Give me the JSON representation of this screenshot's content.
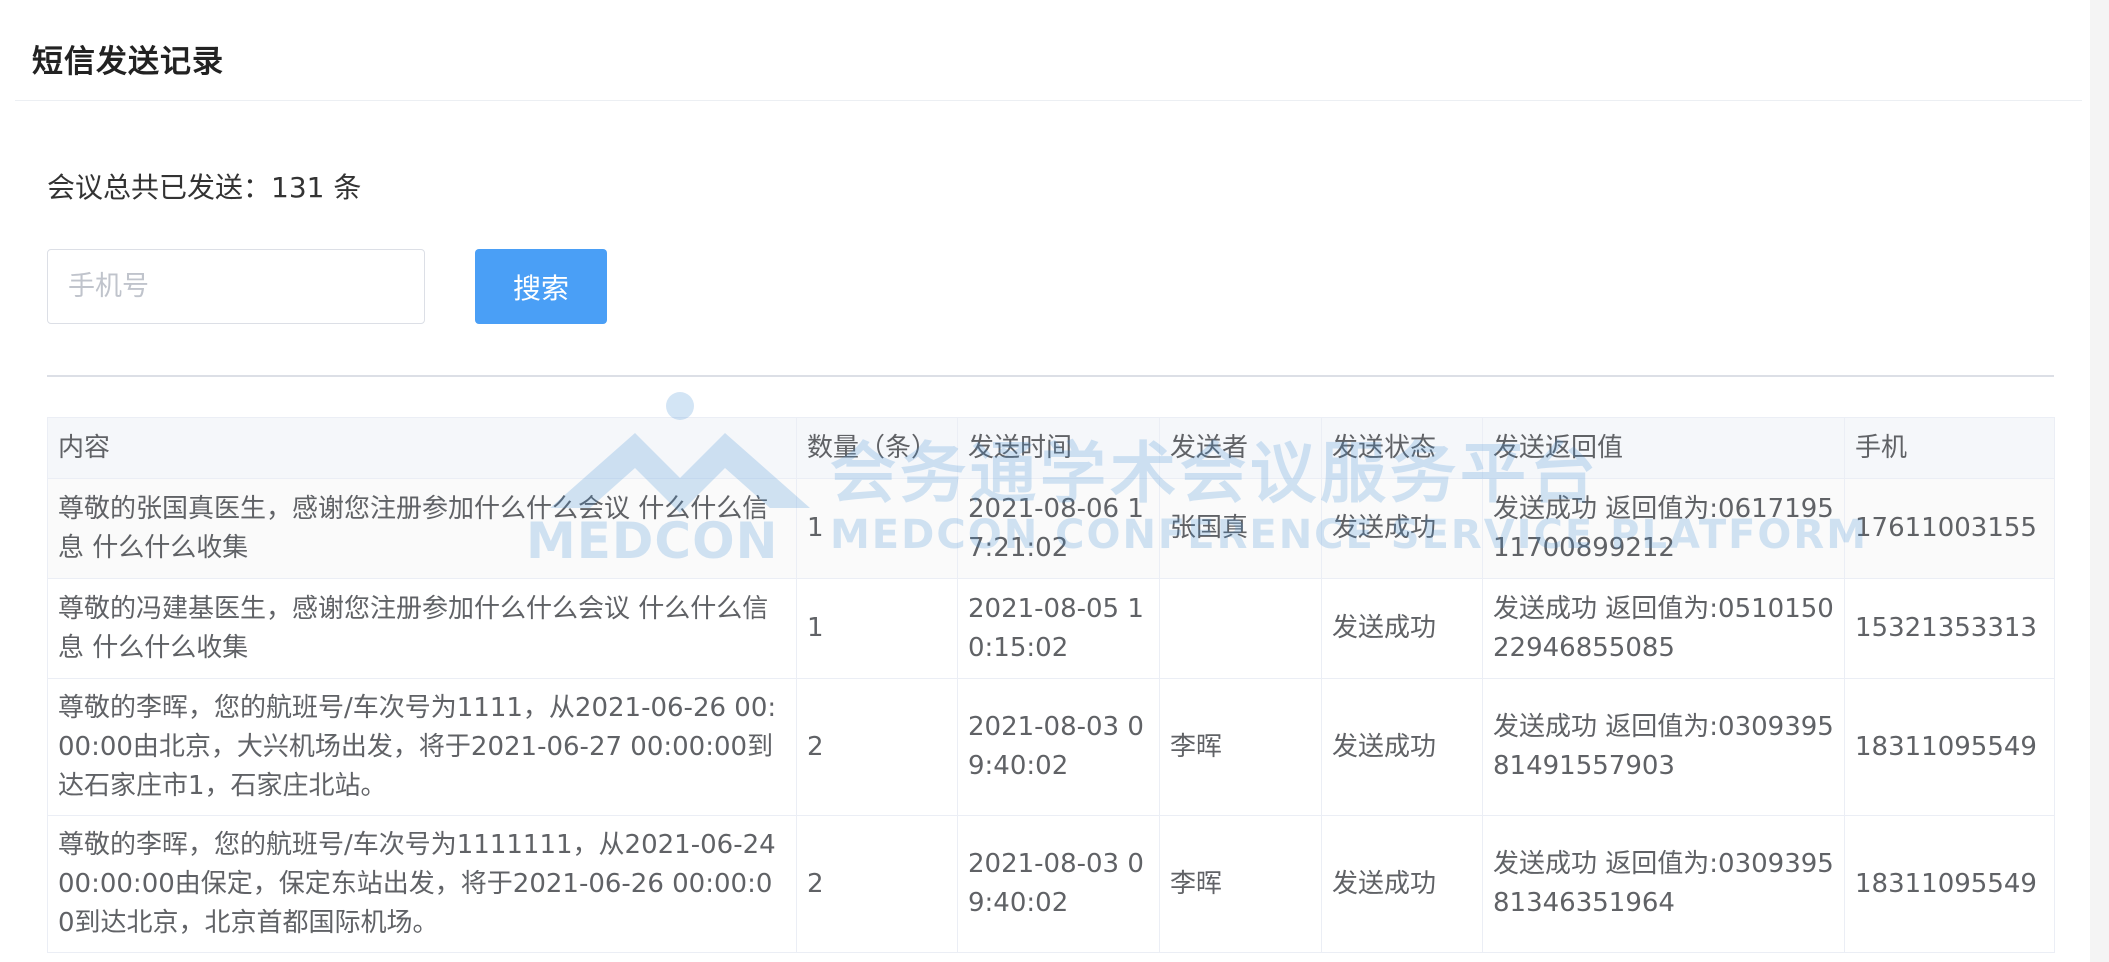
{
  "header": {
    "title": "短信发送记录"
  },
  "summary": {
    "label": "会议总共已发送：",
    "count": "131",
    "unit": "条",
    "text": "会议总共已发送：131 条"
  },
  "search": {
    "placeholder": "手机号",
    "value": "",
    "button_label": "搜索",
    "accent_color": "#4a9ff6"
  },
  "table": {
    "columns": [
      "内容",
      "数量（条）",
      "发送时间",
      "发送者",
      "发送状态",
      "发送返回值",
      "手机"
    ],
    "rows": [
      {
        "content": "尊敬的张国真医生，感谢您注册参加什么什么会议 什么什么信息 什么什么收集",
        "count": "1",
        "time": "2021-08-06 17:21:02",
        "sender": "张国真",
        "status": "发送成功",
        "result": "发送成功 返回值为:061719511700899212",
        "phone": "17611003155"
      },
      {
        "content": "尊敬的冯建基医生，感谢您注册参加什么什么会议 什么什么信息 什么什么收集",
        "count": "1",
        "time": "2021-08-05 10:15:02",
        "sender": "",
        "status": "发送成功",
        "result": "发送成功 返回值为:051015022946855085",
        "phone": "15321353313"
      },
      {
        "content": "尊敬的李晖，您的航班号/车次号为1111，从2021-06-26 00:00:00由北京，大兴机场出发，将于2021-06-27 00:00:00到达石家庄市1，石家庄北站。",
        "count": "2",
        "time": "2021-08-03 09:40:02",
        "sender": "李晖",
        "status": "发送成功",
        "result": "发送成功 返回值为:030939581491557903",
        "phone": "18311095549"
      },
      {
        "content": "尊敬的李晖，您的航班号/车次号为1111111，从2021-06-24 00:00:00由保定，保定东站出发，将于2021-06-26 00:00:00到达北京，北京首都国际机场。",
        "count": "2",
        "time": "2021-08-03 09:40:02",
        "sender": "李晖",
        "status": "发送成功",
        "result": "发送成功 返回值为:030939581346351964",
        "phone": "18311095549"
      }
    ]
  },
  "watermark": {
    "text_cn": "会务通学术会议服务平台",
    "text_en": "MEDCON CONFERENCE SERVICE PLATFORM",
    "logo_text": "MEDCON"
  }
}
